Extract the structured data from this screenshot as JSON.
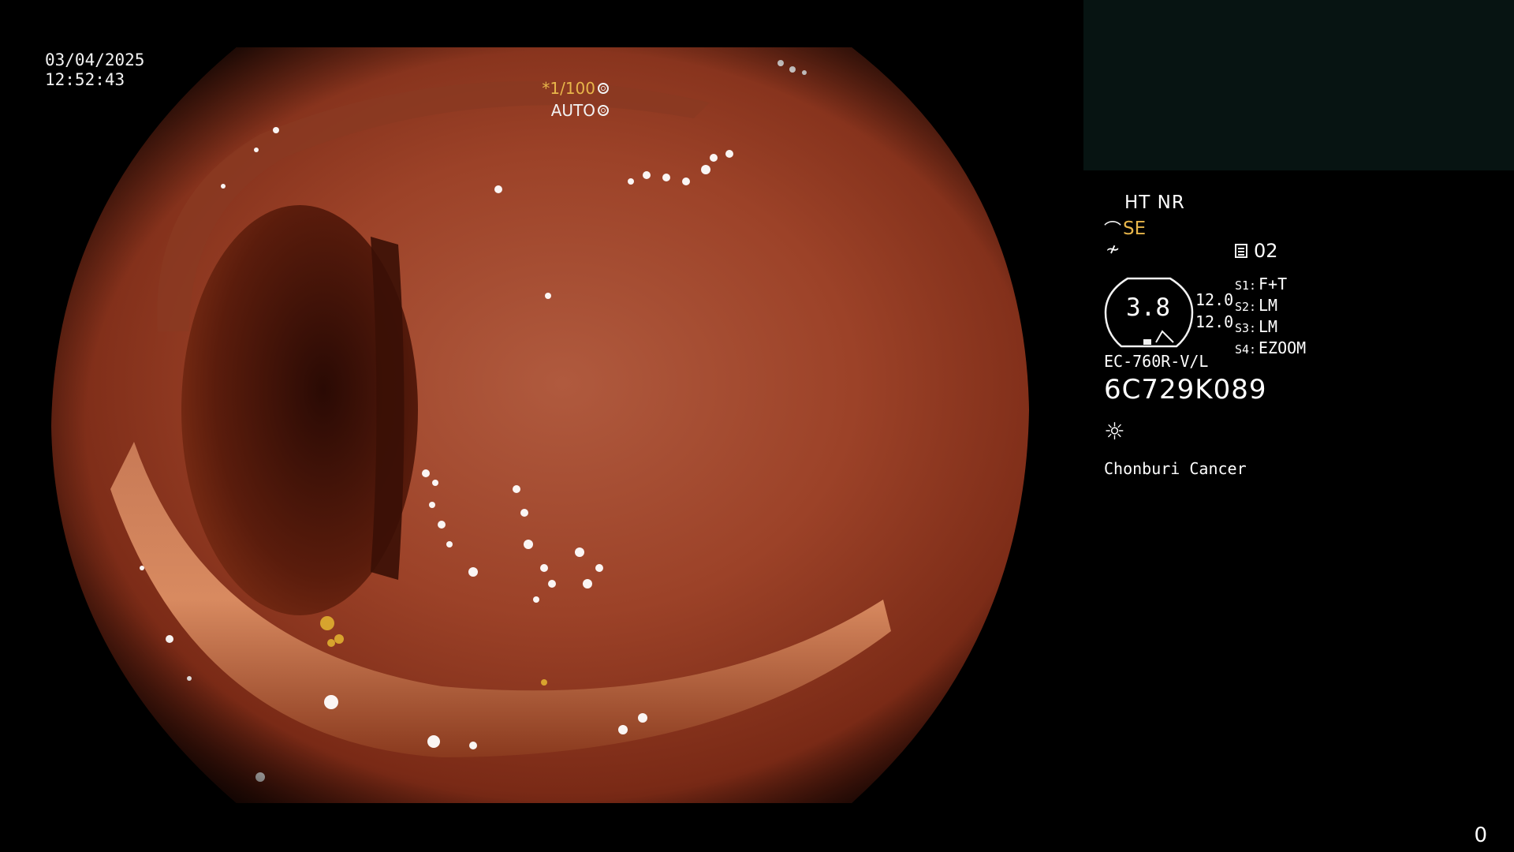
{
  "datetime": {
    "date": "03/04/2025",
    "time": "12:52:43"
  },
  "exposure": {
    "shutter": "*1/100",
    "mode": "AUTO",
    "shutter_icon": "aperture-icon",
    "mode_icon": "iris-icon"
  },
  "panel": {
    "ht_nr": "HT NR",
    "se_symbol": "⌒",
    "se_label": "SE",
    "nf_symbol": "≁",
    "memo_count": "02",
    "zoom_value": "3.8",
    "zoom_side_top": "12.0",
    "zoom_side_bottom": "12.0",
    "switches": [
      {
        "label": "S1:",
        "value": "F+T"
      },
      {
        "label": "S2:",
        "value": "LM"
      },
      {
        "label": "S3:",
        "value": "LM"
      },
      {
        "label": "S4:",
        "value": "EZOOM"
      }
    ],
    "scope_model": "EC-760R-V/L",
    "scope_serial": "6C729K089",
    "light_symbol": "☼",
    "hospital": "Chonburi Cancer"
  },
  "counter": "0",
  "colors": {
    "accent_yellow": "#e8b64a",
    "text": "#f2f2f2",
    "background": "#000000",
    "thumb_box": "#071412"
  }
}
